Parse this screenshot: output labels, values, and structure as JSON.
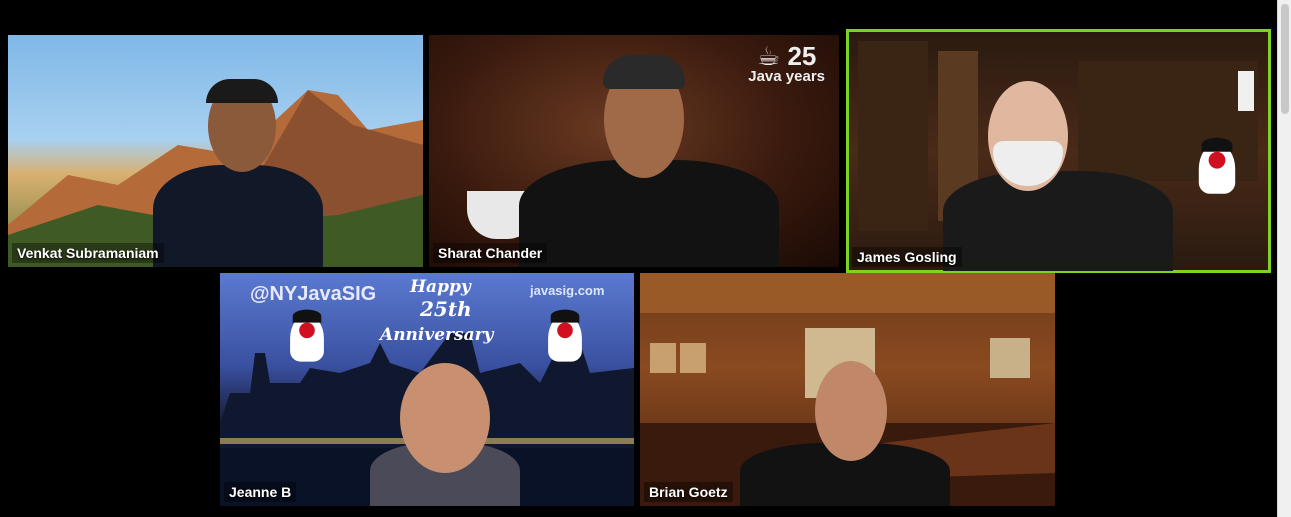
{
  "participants": [
    {
      "name": "Venkat Subramaniam",
      "active": false
    },
    {
      "name": "Sharat Chander",
      "active": false
    },
    {
      "name": "James Gosling",
      "active": true
    },
    {
      "name": "Jeanne B",
      "active": false
    },
    {
      "name": "Brian Goetz",
      "active": false
    }
  ],
  "backgrounds": {
    "sharat": {
      "logo_number": "25",
      "logo_text": "Java years"
    },
    "jeanne": {
      "handle": "@NYJavaSIG",
      "happy": "Happy",
      "number": "25th",
      "anniversary": "Anniversary",
      "site": "javasig.com"
    }
  },
  "colors": {
    "active_speaker_border": "#7ed321",
    "background": "#000000"
  }
}
